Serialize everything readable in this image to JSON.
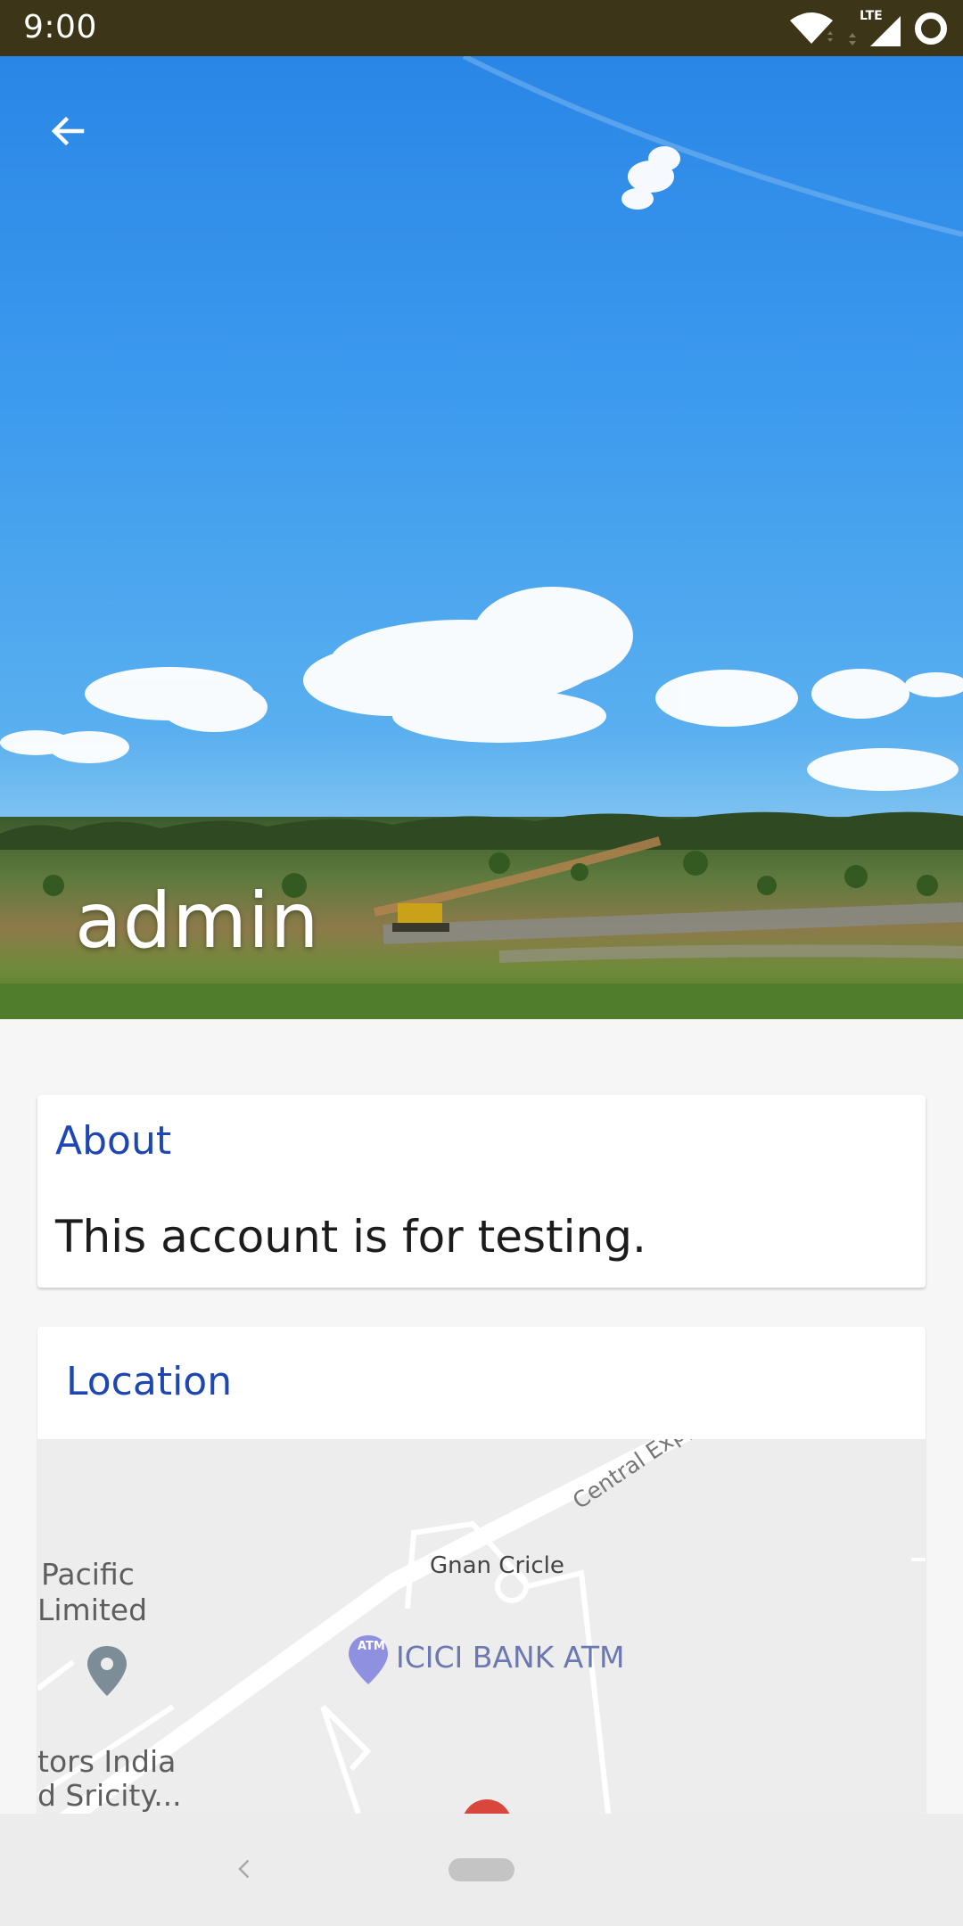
{
  "status_bar": {
    "time": "9:00",
    "network_label": "LTE",
    "icons": [
      "wifi-icon",
      "signal-icon",
      "battery-icon"
    ]
  },
  "hero": {
    "back_icon": "arrow-left-icon",
    "name": "admin"
  },
  "about": {
    "heading": "About",
    "text": "This account is for testing."
  },
  "location": {
    "heading": "Location",
    "map": {
      "labels": {
        "central_expy": "Central Expy",
        "gnan_cricle": "Gnan Cricle",
        "icici": "ICICI BANK ATM",
        "pacific_1": "Pacific",
        "pacific_2": "Limited",
        "tors_1": "tors India",
        "tors_2": "d Sricity..."
      },
      "atm_badge": "ATM"
    }
  },
  "nav_bar": {
    "back_icon": "chevron-left-icon",
    "home_icon": "home-pill-icon"
  },
  "colors": {
    "status_bar": "#3d3517",
    "accent_heading": "#1f47b1",
    "page_background": "#f6f6f6"
  }
}
